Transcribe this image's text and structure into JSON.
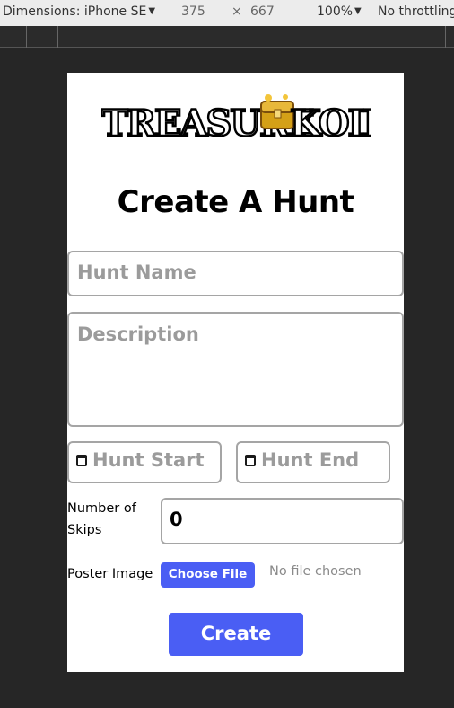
{
  "devtools": {
    "device_label": "Dimensions: iPhone SE",
    "width": "375",
    "times": "×",
    "height": "667",
    "zoom": "100%",
    "throttle": "No throttling"
  },
  "logo": {
    "word1": "TREASURE",
    "word2": "KOII"
  },
  "form": {
    "title": "Create A Hunt",
    "hunt_name_placeholder": "Hunt Name",
    "description_placeholder": "Description",
    "hunt_start_placeholder": "Hunt Start",
    "hunt_end_placeholder": "Hunt End",
    "skips_label_line1": "Number of",
    "skips_label_line2": "Skips",
    "skips_value": "0",
    "poster_label": "Poster Image",
    "choose_file_label": "Choose File",
    "no_file_text": "No file chosen",
    "create_label": "Create"
  },
  "colors": {
    "accent": "#4a5ef4",
    "field_border": "#a5a5a5",
    "placeholder": "#9b9b9b"
  }
}
